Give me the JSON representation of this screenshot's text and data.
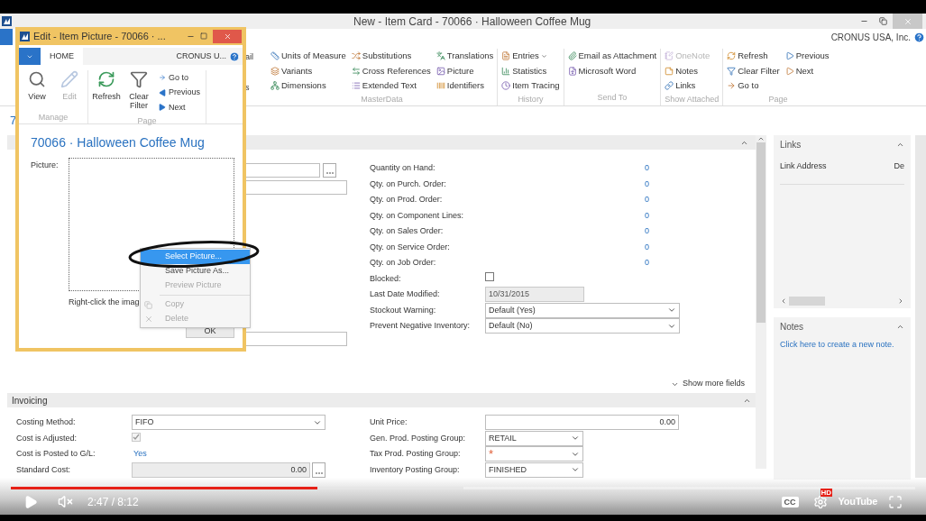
{
  "window": {
    "title": "New - Item Card - 70066 · Halloween Coffee Mug",
    "company": "CRONUS USA, Inc."
  },
  "ribbon": {
    "cut_labels": [
      "ail",
      "s"
    ],
    "groups": [
      {
        "label": "MasterData",
        "columns": [
          [
            {
              "label": "Units of Measure",
              "disabled": false,
              "has_menu": false
            },
            {
              "label": "Variants",
              "disabled": false,
              "has_menu": false
            },
            {
              "label": "Dimensions",
              "disabled": false,
              "has_menu": false
            }
          ],
          [
            {
              "label": "Substitutions",
              "disabled": false,
              "has_menu": false
            },
            {
              "label": "Cross References",
              "disabled": false,
              "has_menu": false
            },
            {
              "label": "Extended Text",
              "disabled": false,
              "has_menu": false
            }
          ],
          [
            {
              "label": "Translations",
              "disabled": false,
              "has_menu": false
            },
            {
              "label": "Picture",
              "disabled": false,
              "has_menu": false
            },
            {
              "label": "Identifiers",
              "disabled": false,
              "has_menu": false
            }
          ]
        ]
      },
      {
        "label": "History",
        "columns": [
          [
            {
              "label": "Entries",
              "disabled": false,
              "has_menu": true
            },
            {
              "label": "Statistics",
              "disabled": false,
              "has_menu": false
            },
            {
              "label": "Item Tracing",
              "disabled": false,
              "has_menu": false
            }
          ]
        ]
      },
      {
        "label": "Send To",
        "columns": [
          [
            {
              "label": "Email as Attachment",
              "disabled": false,
              "has_menu": false
            },
            {
              "label": "Microsoft Word",
              "disabled": false,
              "has_menu": false
            }
          ]
        ]
      },
      {
        "label": "Show Attached",
        "columns": [
          [
            {
              "label": "OneNote",
              "disabled": true,
              "has_menu": false
            },
            {
              "label": "Notes",
              "disabled": false,
              "has_menu": false
            },
            {
              "label": "Links",
              "disabled": false,
              "has_menu": false
            }
          ]
        ]
      },
      {
        "label": "Page",
        "columns": [
          [
            {
              "label": "Refresh",
              "disabled": false,
              "has_menu": false
            },
            {
              "label": "Clear Filter",
              "disabled": false,
              "has_menu": false
            },
            {
              "label": "Go to",
              "disabled": false,
              "has_menu": false
            }
          ],
          [
            {
              "label": "Previous",
              "disabled": false,
              "has_menu": false
            },
            {
              "label": "Next",
              "disabled": false,
              "has_menu": false
            }
          ]
        ]
      }
    ]
  },
  "item_number_fragment": "7",
  "general": {
    "fields": [
      {
        "kind": "link",
        "label": "Quantity on Hand:",
        "value": "0"
      },
      {
        "kind": "link",
        "label": "Qty. on Purch. Order:",
        "value": "0"
      },
      {
        "kind": "link",
        "label": "Qty. on Prod. Order:",
        "value": "0"
      },
      {
        "kind": "link",
        "label": "Qty. on Component Lines:",
        "value": "0"
      },
      {
        "kind": "link",
        "label": "Qty. on Sales Order:",
        "value": "0"
      },
      {
        "kind": "link",
        "label": "Qty. on Service Order:",
        "value": "0"
      },
      {
        "kind": "link",
        "label": "Qty. on Job Order:",
        "value": "0"
      },
      {
        "kind": "checkbox",
        "label": "Blocked:",
        "checked": false,
        "disabled": false
      },
      {
        "kind": "readonly",
        "label": "Last Date Modified:",
        "value": "10/31/2015"
      },
      {
        "kind": "select",
        "label": "Stockout Warning:",
        "value": "Default (Yes)"
      },
      {
        "kind": "select",
        "label": "Prevent Negative Inventory:",
        "value": "Default (No)"
      }
    ],
    "show_more": "Show more fields"
  },
  "invoicing": {
    "title": "Invoicing",
    "left": [
      {
        "kind": "select",
        "label": "Costing Method:",
        "value": "FIFO"
      },
      {
        "kind": "checkbox",
        "label": "Cost is Adjusted:",
        "checked": true,
        "disabled": true
      },
      {
        "kind": "link",
        "label": "Cost is Posted to G/L:",
        "value": "Yes"
      },
      {
        "kind": "lookup",
        "label": "Standard Cost:",
        "value": "0.00"
      }
    ],
    "right": [
      {
        "kind": "number",
        "label": "Unit Price:",
        "value": "0.00"
      },
      {
        "kind": "select",
        "label": "Gen. Prod. Posting Group:",
        "value": "RETAIL"
      },
      {
        "kind": "required",
        "label": "Tax Prod. Posting Group:",
        "value": "*"
      },
      {
        "kind": "select",
        "label": "Inventory Posting Group:",
        "value": "FINISHED"
      }
    ]
  },
  "factbox": {
    "links": {
      "title": "Links",
      "columns": [
        "Link Address",
        "De"
      ]
    },
    "notes": {
      "title": "Notes",
      "link": "Click here to create a new note."
    }
  },
  "dialog": {
    "title": "Edit - Item Picture - 70066 · ...",
    "tab": "HOME",
    "company": "CRONUS U...",
    "groups": [
      {
        "label": "Manage",
        "large": [
          {
            "label": "View",
            "disabled": false
          },
          {
            "label": "Edit",
            "disabled": true
          }
        ]
      },
      {
        "label": "Page",
        "large": [
          {
            "label": "Refresh",
            "disabled": false
          },
          {
            "label": "Clear Filter",
            "disabled": false
          }
        ],
        "small": [
          {
            "label": "Go to"
          },
          {
            "label": "Previous"
          },
          {
            "label": "Next"
          }
        ]
      }
    ],
    "heading": "70066 · Halloween Coffee Mug",
    "field_label": "Picture:",
    "hint": "Right-click the imag",
    "ok": "OK"
  },
  "context_menu": {
    "sections": [
      [
        {
          "label": "Select Picture...",
          "selected": true,
          "disabled": false
        },
        {
          "label": "Save Picture As...",
          "selected": false,
          "disabled": false
        },
        {
          "label": "Preview Picture",
          "selected": false,
          "disabled": true
        }
      ],
      [
        {
          "label": "Copy",
          "selected": false,
          "disabled": true
        },
        {
          "label": "Delete",
          "selected": false,
          "disabled": true
        }
      ]
    ]
  },
  "player": {
    "playing": false,
    "muted": true,
    "progress": {
      "level": 0.339
    },
    "buffered": {
      "level": 0.5
    },
    "time": "2:47 / 8:12",
    "cc": "CC",
    "hd": "HD",
    "logo": "YouTube"
  }
}
